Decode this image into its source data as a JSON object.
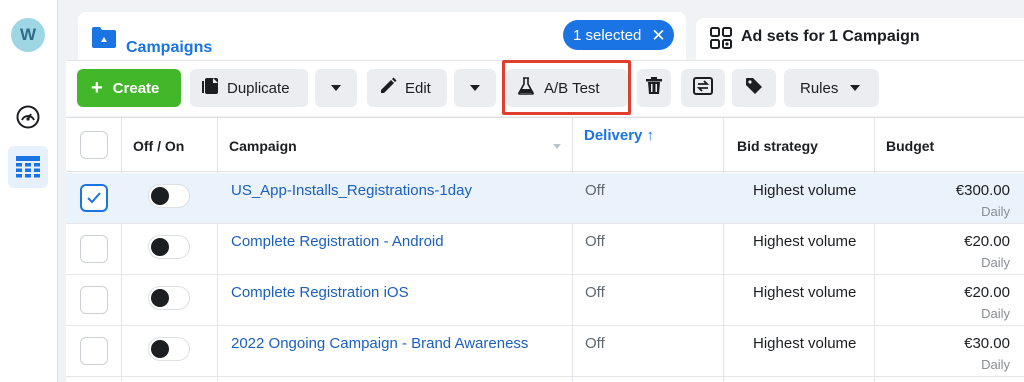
{
  "account": {
    "avatar_letter": "W"
  },
  "rail": {
    "icons": [
      "dashboard-gauge-icon",
      "table-grid-icon"
    ]
  },
  "tabs": {
    "campaigns": {
      "label": "Campaigns",
      "selected_label": "1 selected",
      "clear_symbol": "✕"
    },
    "adsets": {
      "label": "Ad sets for 1 Campaign"
    }
  },
  "toolbar": {
    "create_label": "Create",
    "create_symbol": "+",
    "duplicate_label": "Duplicate",
    "edit_label": "Edit",
    "ab_test_label": "A/B Test",
    "rules_label": "Rules"
  },
  "table": {
    "columns": [
      "Off / On",
      "Campaign",
      "Delivery ↑",
      "Bid strategy",
      "Budget"
    ],
    "rows": [
      {
        "selected": true,
        "on": false,
        "name": "US_App-Installs_Registrations-1day",
        "delivery": "Off",
        "bid": "Highest volume",
        "budget": "€300.00",
        "budget_period": "Daily"
      },
      {
        "selected": false,
        "on": false,
        "name": "Complete Registration - Android",
        "delivery": "Off",
        "bid": "Highest volume",
        "budget": "€20.00",
        "budget_period": "Daily"
      },
      {
        "selected": false,
        "on": false,
        "name": "Complete Registration iOS",
        "delivery": "Off",
        "bid": "Highest volume",
        "budget": "€20.00",
        "budget_period": "Daily"
      },
      {
        "selected": false,
        "on": false,
        "name": "2022 Ongoing Campaign - Brand Awareness",
        "delivery": "Off",
        "bid": "Highest volume",
        "budget": "€30.00",
        "budget_period": "Daily"
      }
    ]
  },
  "colors": {
    "accent": "#1b74e4",
    "create": "#42b72a",
    "highlight": "#e03e2f"
  }
}
